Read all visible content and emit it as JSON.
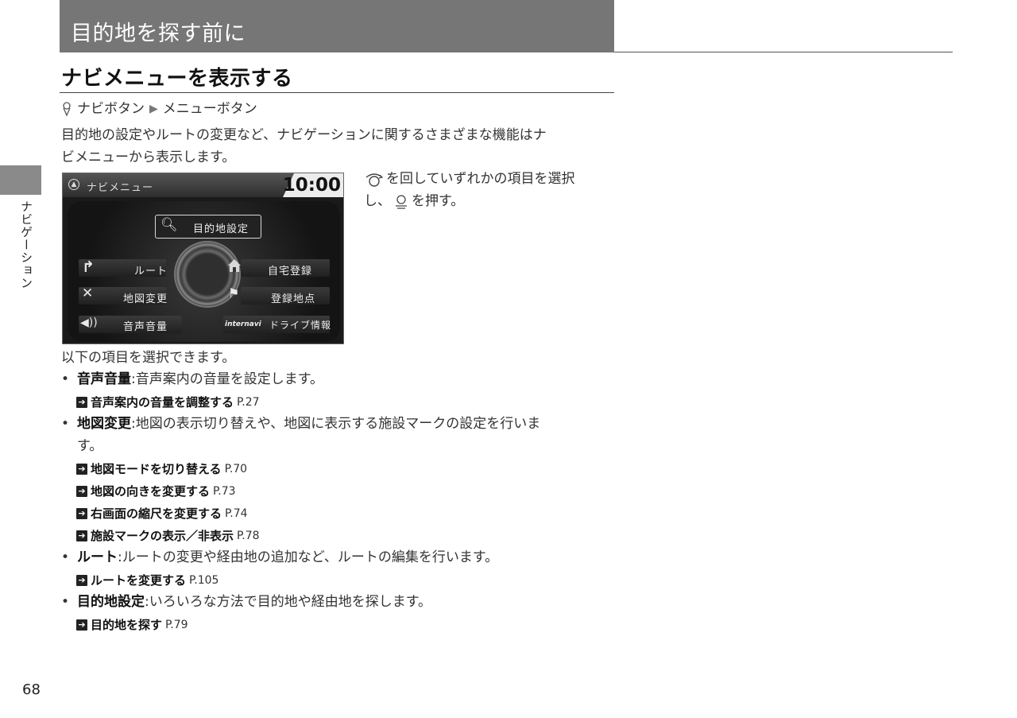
{
  "chapter_title": "目的地を探す前に",
  "section_title": "ナビメニューを表示する",
  "side_tab_label": "ナビゲーション",
  "breadcrumb": {
    "step1": "ナビボタン",
    "step2": "メニューボタン"
  },
  "intro_line1": "目的地の設定やルートの変更など、ナビゲーションに関するさまざまな機能はナ",
  "intro_line2": "ビメニューから表示します。",
  "screen": {
    "header_label": "ナビメニュー",
    "clock": "10:00",
    "items": {
      "destination": "目的地設定",
      "route": "ルート",
      "home": "自宅登録",
      "map_change": "地図変更",
      "registered": "登録地点",
      "volume": "音声音量",
      "internavi_brand": "internavi",
      "internavi_label": "ドライブ情報"
    }
  },
  "caption_line1": "を回していずれかの項目を選択",
  "caption_line2_pre": "し、",
  "caption_line2_post": "を押す。",
  "list_intro": "以下の項目を選択できます。",
  "items": [
    {
      "term": "音声音量",
      "desc": "音声案内の音量を設定します。"
    },
    {
      "term": "地図変更",
      "desc": "地図の表示切り替えや、地図に表示する施設マークの設定を行いま",
      "desc_cont": "す。"
    },
    {
      "term": "ルート",
      "desc": "ルートの変更や経由地の追加など、ルートの編集を行います。"
    },
    {
      "term": "目的地設定",
      "desc": "いろいろな方法で目的地や経由地を探します。"
    }
  ],
  "refs": [
    {
      "title": "音声案内の音量を調整する",
      "page": "P.27"
    },
    {
      "title": "地図モードを切り替える",
      "page": "P.70"
    },
    {
      "title": "地図の向きを変更する",
      "page": "P.73"
    },
    {
      "title": "右画面の縮尺を変更する",
      "page": "P.74"
    },
    {
      "title": "施設マークの表示／非表示",
      "page": "P.78"
    },
    {
      "title": "ルートを変更する",
      "page": "P.105"
    },
    {
      "title": "目的地を探す",
      "page": "P.79"
    }
  ],
  "page_number": "68"
}
